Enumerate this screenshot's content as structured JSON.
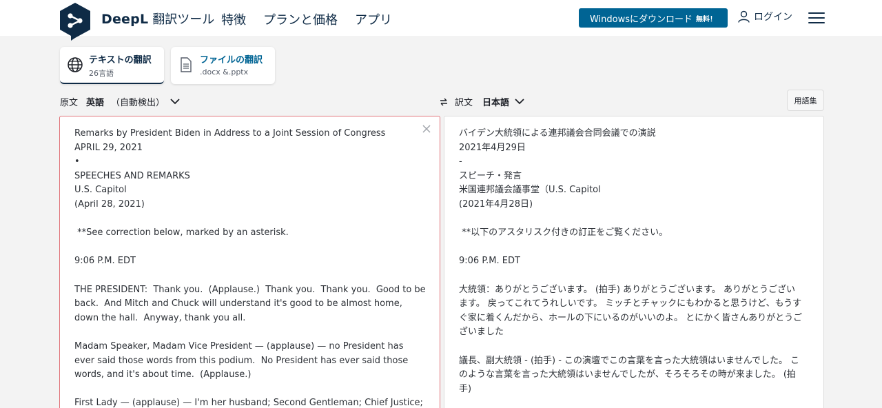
{
  "header": {
    "brand": "DeepL",
    "brand_sub": "翻訳ツール",
    "nav": [
      "特徴",
      "プランと価格",
      "アプリ"
    ],
    "download_label": "Windowsにダウンロード",
    "download_free": "無料！",
    "login_label": "ログイン",
    "colors": {
      "brand_dark": "#0f2b46",
      "download_bg": "#006494"
    }
  },
  "tabs": [
    {
      "title": "テキストの翻訳",
      "sub": "26言語",
      "icon": "globe-icon",
      "active": true
    },
    {
      "title": "ファイルの翻訳",
      "sub": ".docx &.pptx",
      "icon": "document-icon",
      "active": false
    }
  ],
  "source_lang": {
    "label": "原文",
    "language": "英語",
    "detected": "（自動検出）"
  },
  "target_lang": {
    "label": "訳文",
    "language": "日本語"
  },
  "glossary_label": "用語集",
  "source_text": "Remarks by President Biden in Address to a Joint Session of Congress\nAPRIL 29, 2021\n•\nSPEECHES AND REMARKS\nU.S. Capitol\n(April 28, 2021)\n\n **See correction below, marked by an asterisk.\n\n9:06 P.M. EDT\n\nTHE PRESIDENT:  Thank you.  (Applause.)  Thank you.  Thank you.  Good to be back.  And Mitch and Chuck will understand it's good to be almost home, down the hall.  Anyway, thank you all.\n\nMadam Speaker, Madam Vice President — (applause) — no President has ever said those words from this podium.  No President has ever said those words, and it's about time.  (Applause.)\n\nFirst Lady — (applause) — I'm her husband; Second Gentleman; Chief Justice;",
  "target_text": "バイデン大統領による連邦議会合同会議での演説\n2021年4月29日\n-\nスピーチ・発言\n米国連邦議会議事堂（U.S. Capitol\n(2021年4月28日)\n\n **以下のアスタリスク付きの訂正をご覧ください。\n\n9:06 P.M. EDT\n\n大統領：ありがとうございます。 (拍手) ありがとうございます。 ありがとうございます。 戻ってこれてうれしいです。 ミッチとチャックにもわかると思うけど、もうすぐ家に着くんだから、ホールの下にいるのがいいのよ。 とにかく皆さんありがとうございました\n\n議長、副大統領 - (拍手) - この演壇でこの言葉を言った大統領はいませんでした。 このような言葉を言った大統領はいませんでしたが、そろそろその時が来ました。 (拍手)"
}
